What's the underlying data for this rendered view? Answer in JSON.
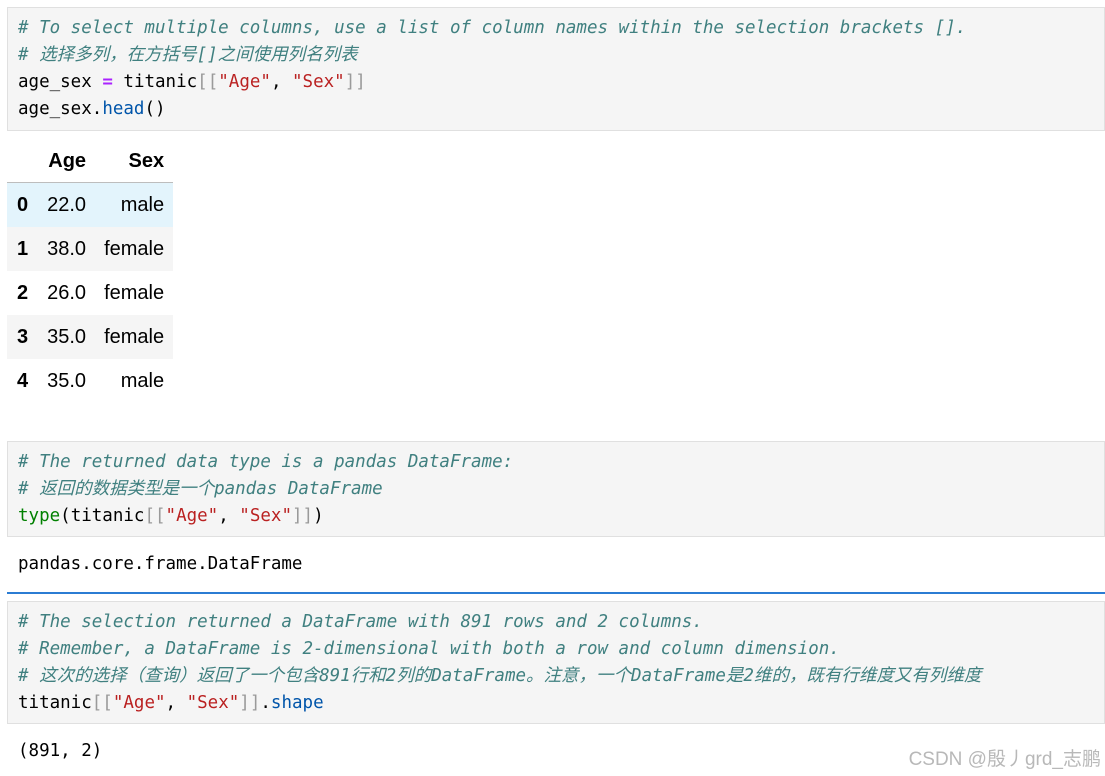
{
  "cell1": {
    "comment_en": "# To select multiple columns, use a list of column names within the selection brackets [].",
    "comment_zh": "# 选择多列，在方括号[]之间使用列名列表",
    "line3": {
      "var": "age_sex",
      "op": "=",
      "obj": "titanic",
      "open": "[[",
      "s1": "\"Age\"",
      "comma": ", ",
      "s2": "\"Sex\"",
      "close": "]]"
    },
    "line4": {
      "obj": "age_sex",
      "dot": ".",
      "method": "head",
      "parens": "()"
    }
  },
  "dataframe": {
    "columns": [
      "Age",
      "Sex"
    ],
    "rows": [
      {
        "index": "0",
        "age": "22.0",
        "sex": "male"
      },
      {
        "index": "1",
        "age": "38.0",
        "sex": "female"
      },
      {
        "index": "2",
        "age": "26.0",
        "sex": "female"
      },
      {
        "index": "3",
        "age": "35.0",
        "sex": "female"
      },
      {
        "index": "4",
        "age": "35.0",
        "sex": "male"
      }
    ]
  },
  "cell2": {
    "comment_en": "# The returned data type is a pandas DataFrame:",
    "comment_zh": "# 返回的数据类型是一个pandas DataFrame",
    "code": {
      "fn": "type",
      "open": "(titanic",
      "br_open": "[[",
      "s1": "\"Age\"",
      "comma": ", ",
      "s2": "\"Sex\"",
      "br_close": "]]",
      "close": ")"
    },
    "output": "pandas.core.frame.DataFrame"
  },
  "cell3": {
    "comment1": "# The selection returned a DataFrame with 891 rows and 2 columns.",
    "comment2": "# Remember, a DataFrame is 2-dimensional with both a row and column dimension.",
    "comment3": "# 这次的选择（查询）返回了一个包含891行和2列的DataFrame。注意，一个DataFrame是2维的，既有行维度又有列维度",
    "code": {
      "obj": "titanic",
      "br_open": "[[",
      "s1": "\"Age\"",
      "comma": ", ",
      "s2": "\"Sex\"",
      "br_close": "]]",
      "dot": ".",
      "attr": "shape"
    },
    "output": "(891, 2)"
  },
  "watermark": "CSDN @殷丿grd_志鹏"
}
